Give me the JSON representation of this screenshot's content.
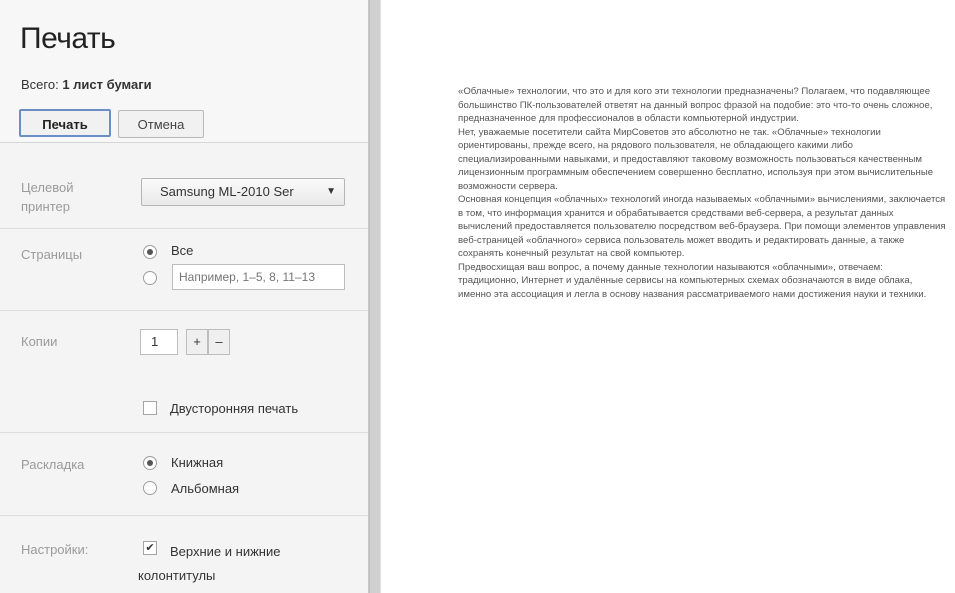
{
  "header": {
    "title": "Печать",
    "total_label": "Всего:",
    "total_value": "1 лист бумаги",
    "print_button": "Печать",
    "cancel_button": "Отмена"
  },
  "settings": {
    "printer": {
      "label_line1": "Целевой",
      "label_line2": "принтер",
      "value": "Samsung ML-2010 Ser"
    },
    "pages": {
      "label": "Страницы",
      "option_all": "Все",
      "range_placeholder": "Например, 1–5, 8, 11–13",
      "selected": "all"
    },
    "copies": {
      "label": "Копии",
      "value": "1",
      "plus": "+",
      "minus": "–"
    },
    "duplex": {
      "label": "Двусторонняя печать",
      "checked": false
    },
    "layout": {
      "label": "Раскладка",
      "portrait": "Книжная",
      "landscape": "Альбомная",
      "selected": "portrait"
    },
    "options": {
      "label": "Настройки:",
      "headers_line1": "Верхние и нижние",
      "headers_line2": "колонтитулы",
      "checked": true
    }
  },
  "preview": {
    "paragraphs": [
      "«Облачные» технологии, что это и для кого эти технологии предназначены? Полагаем, что подавляющее большинство ПК-пользователей ответят на данный вопрос фразой на подобие: это что-то очень сложное, предназначенное для профессионалов в области компьютерной индустрии.",
      "Нет, уважаемые посетители сайта МирСоветов это абсолютно не так. «Облачные» технологии ориентированы, прежде всего, на рядового пользователя, не обладающего какими либо специализированными навыками, и предоставляют таковому возможность пользоваться качественным лицензионным программным обеспечением совершенно бесплатно, используя при этом вычислительные возможности сервера.",
      "Основная концепция «облачных» технологий иногда называемых «облачными» вычислениями, заключается в том, что информация хранится и обрабатывается средствами веб-сервера, а результат данных вычислений предоставляется пользователю посредством веб-браузера. При помощи элементов управления веб-страницей «облачного» сервиса пользователь может вводить и редактировать данные, а также сохранять конечный результат на свой компьютер.",
      "Предвосхищая ваш вопрос, а почему данные технологии называются «облачными», отвечаем: традиционно, Интернет и удалённые сервисы на компьютерных схемах обозначаются в виде облака, именно эта ассоциация и легла в основу названия рассматриваемого нами достижения науки и техники."
    ]
  }
}
